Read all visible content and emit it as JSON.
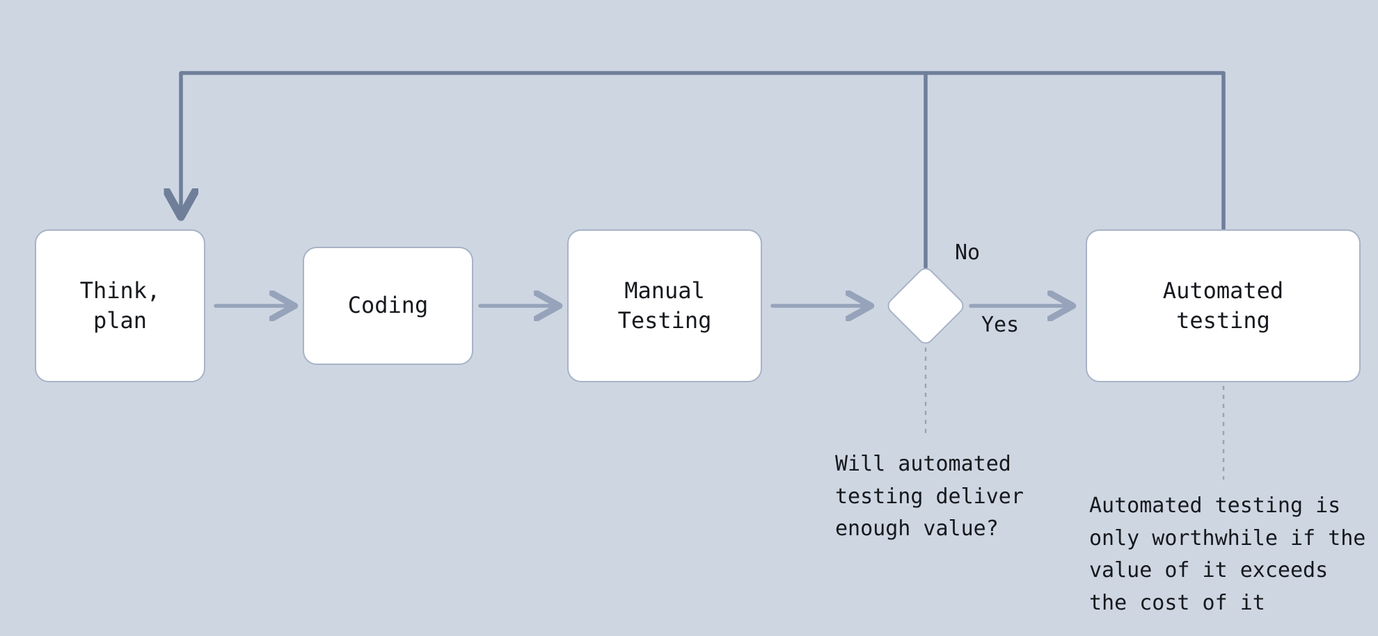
{
  "nodes": {
    "think_plan": "Think,\nplan",
    "coding": "Coding",
    "manual_testing": "Manual\nTesting",
    "automated_testing": "Automated\ntesting"
  },
  "decision": {
    "no_label": "No",
    "yes_label": "Yes",
    "note": "Will automated testing deliver enough value?"
  },
  "automated_note": "Automated testing is only worthwhile if the value of it exceeds the cost of it",
  "colors": {
    "bg": "#ced6e2",
    "node_fill": "#ffffff",
    "node_border": "#a7b3c6",
    "arrow": "#96a3ba",
    "feedback_line": "#6f7f9a",
    "dashed": "#9aa4b6",
    "text": "#16191d"
  }
}
